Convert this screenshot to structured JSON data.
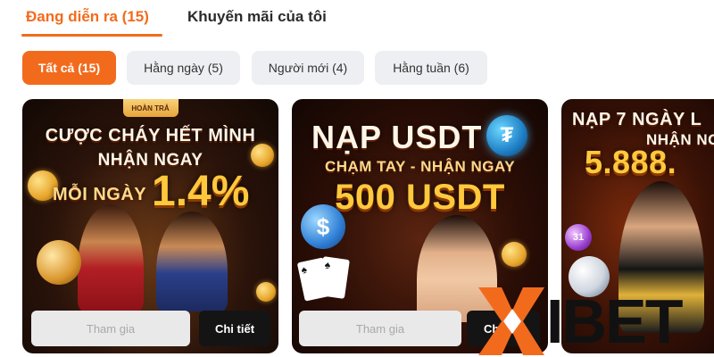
{
  "top_tabs": {
    "ongoing": "Đang diễn ra (15)",
    "my_promos": "Khuyến mãi của tôi"
  },
  "filters": [
    {
      "label": "Tất cả (15)",
      "active": true
    },
    {
      "label": "Hằng ngày (5)",
      "active": false
    },
    {
      "label": "Người mới (4)",
      "active": false
    },
    {
      "label": "Hằng tuần (6)",
      "active": false
    }
  ],
  "cards": [
    {
      "badge": "HOÀN TRẢ",
      "line1": "CƯỢC CHÁY HẾT MÌNH",
      "line2": "NHẬN NGAY",
      "line3_prefix": "MỖI NGÀY",
      "line3_value": "1.4%",
      "join_label": "Tham gia",
      "detail_label": "Chi tiết"
    },
    {
      "line1": "NẠP USDT",
      "line2": "CHẠM TAY - NHẬN NGAY",
      "line3": "500 USDT",
      "join_label": "Tham gia",
      "detail_label": "Chi tiết"
    },
    {
      "line1": "NẠP 7 NGÀY L",
      "line2": "NHẬN NG",
      "line3": "5.888.",
      "ball_number": "31"
    }
  ],
  "watermark": {
    "brand": "IBET",
    "colors": {
      "mark": "#f26b1d",
      "text": "#111111"
    }
  },
  "colors": {
    "accent": "#f26b1d",
    "chip_bg": "#eeeff2",
    "detail_btn": "#141414",
    "join_btn": "#e9e9ea"
  }
}
